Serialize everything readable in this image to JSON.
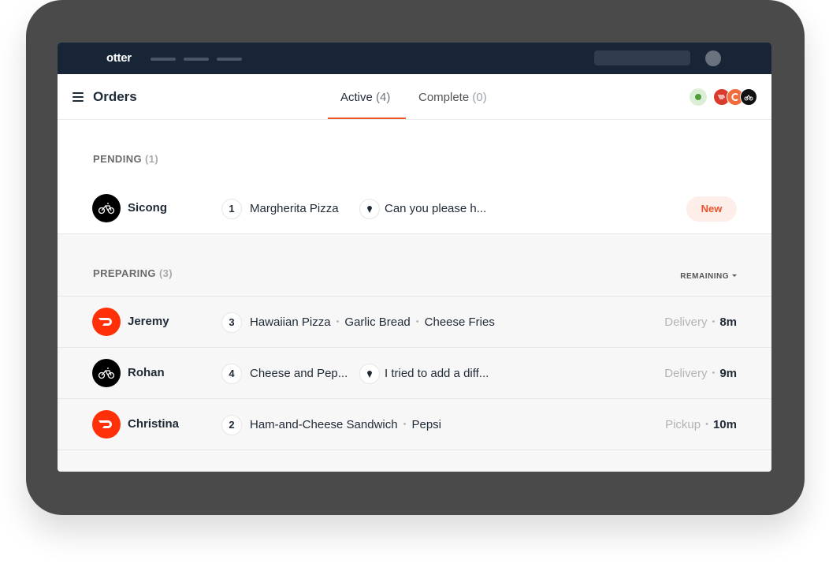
{
  "app": {
    "brand": "otter"
  },
  "header": {
    "title": "Orders",
    "tabs": [
      {
        "label": "Active",
        "count": "(4)"
      },
      {
        "label": "Complete",
        "count": "(0)"
      }
    ]
  },
  "sections": {
    "pending": {
      "label": "PENDING",
      "count": "(1)"
    },
    "preparing": {
      "label": "PREPARING",
      "count": "(3)",
      "sort_label": "REMAINING"
    }
  },
  "orders": [
    {
      "customer": "Sicong",
      "provider": "postmates-icon",
      "qty": "1",
      "items": [
        "Margherita Pizza"
      ],
      "note": "Can you please h...",
      "badge": "New"
    },
    {
      "customer": "Jeremy",
      "provider": "doordash-icon",
      "qty": "3",
      "items": [
        "Hawaiian Pizza",
        "Garlic Bread",
        "Cheese Fries"
      ],
      "mode": "Delivery",
      "time": "8m"
    },
    {
      "customer": "Rohan",
      "provider": "postmates-icon",
      "qty": "4",
      "items": [
        "Cheese and Pep..."
      ],
      "note": "I tried to add a diff...",
      "mode": "Delivery",
      "time": "9m"
    },
    {
      "customer": "Christina",
      "provider": "doordash-icon",
      "qty": "2",
      "items": [
        "Ham-and-Cheese Sandwich",
        "Pepsi"
      ],
      "mode": "Pickup",
      "time": "10m"
    }
  ],
  "colors": {
    "accent": "#f0552a",
    "nav": "#172537",
    "doordash": "#ff3008",
    "postmates": "#000000",
    "status_online": "#4f9e3a"
  }
}
